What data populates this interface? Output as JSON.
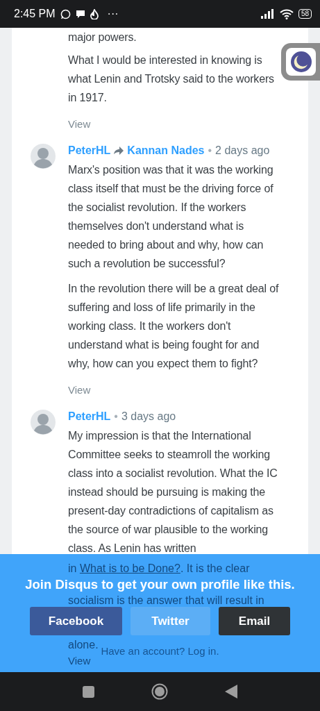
{
  "status_bar": {
    "time": "2:45 PM",
    "more": "···",
    "battery": "58"
  },
  "comments": [
    {
      "paragraphs": [
        "major powers.",
        "What I would be interested in knowing is what Lenin and Trotsky said to the workers in 1917."
      ],
      "view": "View"
    },
    {
      "author": "PeterHL",
      "recipient": "Kannan Nades",
      "separator": "•",
      "time": "2 days ago",
      "paragraphs": [
        "Marx's position was that it was the working class itself that must be the driving force of the socialist revolution. If the workers themselves don't understand what is needed to bring about and why, how can such a revolution be successful?",
        "In the revolution there will be a great deal of suffering and loss of life primarily in the working class. It the workers don't understand what is being fought for and why, how can you expect them to fight?"
      ],
      "view": "View"
    },
    {
      "author": "PeterHL",
      "separator": "•",
      "time": "3 days ago",
      "paragraphs": [
        "My impression is that the International Committee seeks to steamroll the working class into a socialist revolution. What the IC instead should be pursuing is making the present-day contradictions of capitalism as the source of war plausible to the working class. As Lenin has written"
      ],
      "tail": [
        {
          "before": "in ",
          "link": "What is to be Done?",
          "after": ". It is the clear"
        },
        {
          "before": "socialism is the answer that will result in"
        },
        {
          "before": "alone."
        }
      ],
      "view": "View"
    }
  ],
  "join_banner": {
    "headline": "Join Disqus to get your own profile like this.",
    "buttons": [
      {
        "label": "Facebook",
        "kind": "facebook"
      },
      {
        "label": "Twitter",
        "kind": "twitter"
      },
      {
        "label": "Email",
        "kind": "email"
      }
    ],
    "login_prompt": "Have an account?",
    "login_link": "Log in."
  }
}
